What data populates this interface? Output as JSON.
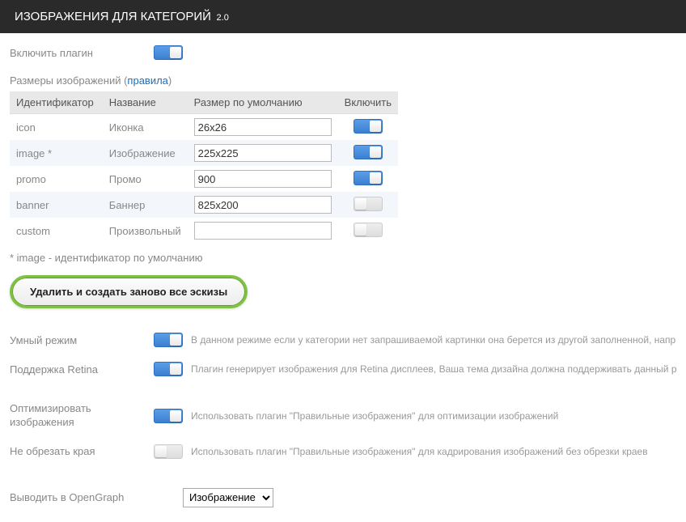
{
  "header": {
    "title": "ИЗОБРАЖЕНИЯ ДЛЯ КАТЕГОРИЙ",
    "version": "2.0"
  },
  "enable": {
    "label": "Включить плагин",
    "on": true
  },
  "sizes": {
    "label": "Размеры изображений (",
    "rules_link": "правила",
    "label_end": ")",
    "cols": {
      "id": "Идентификатор",
      "name": "Название",
      "size": "Размер по умолчанию",
      "enable": "Включить"
    },
    "rows": [
      {
        "id": "icon",
        "name": "Иконка",
        "size": "26x26",
        "on": true,
        "alt": false
      },
      {
        "id": "image *",
        "name": "Изображение",
        "size": "225x225",
        "on": true,
        "alt": true
      },
      {
        "id": "promo",
        "name": "Промо",
        "size": "900",
        "on": true,
        "alt": false
      },
      {
        "id": "banner",
        "name": "Баннер",
        "size": "825x200",
        "on": false,
        "alt": true
      },
      {
        "id": "custom",
        "name": "Произвольный",
        "size": "",
        "on": false,
        "alt": false
      }
    ],
    "footnote": "* image - идентификатор по умолчанию"
  },
  "regen_btn": "Удалить и создать заново все эскизы",
  "options": {
    "smart": {
      "label": "Умный режим",
      "on": true,
      "desc": "В данном режиме если у категории нет запрашиваемой картинки она берется из другой заполненной, например icon из"
    },
    "retina": {
      "label": "Поддержка Retina",
      "on": true,
      "desc": "Плагин генерирует изображения для Retina дисплеев, Ваша тема дизайна должна поддерживать данный режим"
    },
    "optimize": {
      "label": "Оптимизировать изображения",
      "on": true,
      "desc": "Использовать плагин \"Правильные изображения\" для оптимизации изображений"
    },
    "nocrop": {
      "label": "Не обрезать края",
      "on": false,
      "desc": "Использовать плагин \"Правильные изображения\" для кадрирования изображений без обрезки краев"
    }
  },
  "opengraph": {
    "label": "Выводить в OpenGraph",
    "value": "Изображение"
  }
}
